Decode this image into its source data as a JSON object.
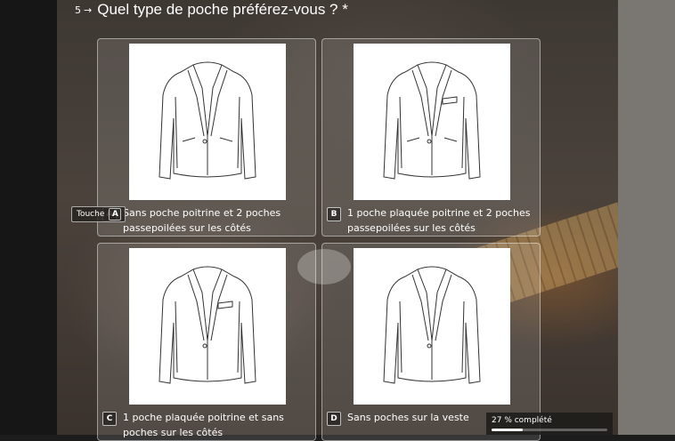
{
  "question": {
    "number": "5",
    "arrow": "→",
    "text": "Quel type de poche préférez-vous ? *"
  },
  "options": [
    {
      "key": "A",
      "label": "Sans poche poitrine et 2 poches passepoilées sur les côtés",
      "image_icon": "jacket-no-chest-pocket-icon"
    },
    {
      "key": "B",
      "label": "1 poche plaquée poitrine et 2 poches passepoilées sur les côtés",
      "image_icon": "jacket-chest-and-side-pockets-icon"
    },
    {
      "key": "C",
      "label": "1 poche plaquée poitrine et sans poches sur les côtés",
      "image_icon": "jacket-chest-pocket-only-icon"
    },
    {
      "key": "D",
      "label": "Sans poches sur la veste",
      "image_icon": "jacket-no-pockets-icon"
    }
  ],
  "key_hint": {
    "label": "Touche",
    "key": "A"
  },
  "progress": {
    "text": "27 % complété",
    "percent": 27
  },
  "colors": {
    "text": "#ffffff",
    "card_border": "rgba(255,255,255,0.45)",
    "progress_bg": "#1e1c1a"
  }
}
